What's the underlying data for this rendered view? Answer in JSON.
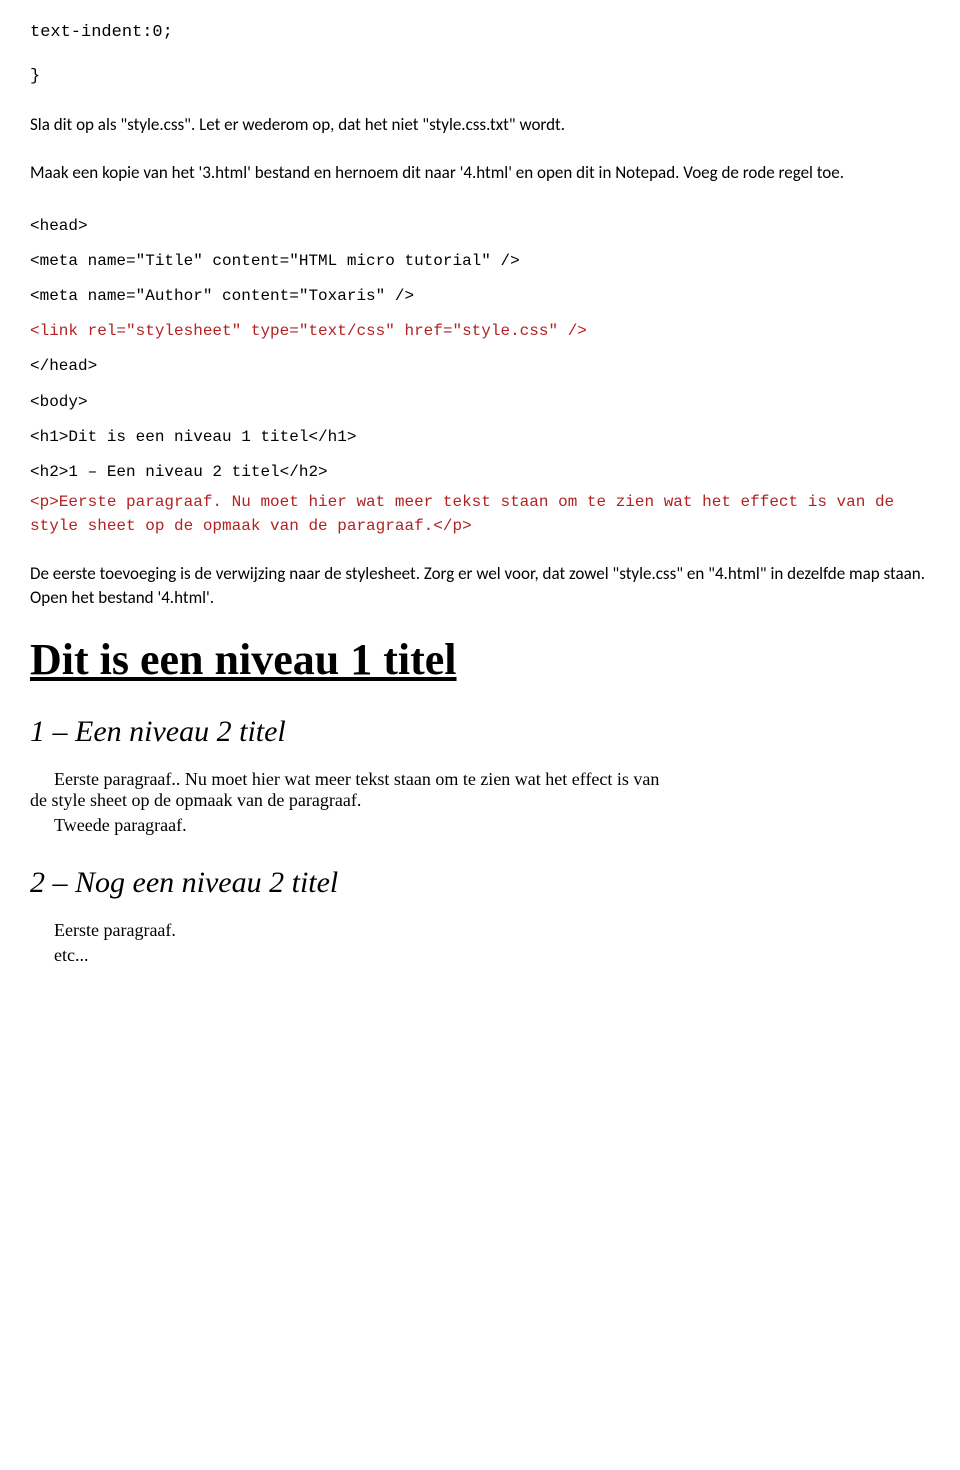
{
  "css_fragment": {
    "line1": "text-indent:0;",
    "line2": "}"
  },
  "instr1": "Sla dit op als \"style.css\". Let er wederom op, dat het niet \"style.css.txt\" wordt.",
  "instr2": "Maak een kopie van het '3.html' bestand en hernoem dit naar '4.html' en open dit in Notepad. Voeg de rode regel toe.",
  "code": {
    "l1": "<head>",
    "l2": "<meta name=\"Title\" content=\"HTML micro tutorial\" />",
    "l3": "<meta name=\"Author\" content=\"Toxaris\" />",
    "l4": "<link rel=\"stylesheet\" type=\"text/css\" href=\"style.css\" />",
    "l5": "</head>",
    "l6": "<body>",
    "l7": "<h1>Dit is een niveau 1 titel</h1>",
    "l8": "<h2>1 – Een niveau 2 titel</h2>",
    "l9": "<p>Eerste paragraaf. Nu moet hier wat meer tekst staan om te zien wat het effect is van de style sheet op de opmaak van de paragraaf.</p>"
  },
  "instr3": "De eerste toevoeging is de verwijzing naar de stylesheet. Zorg er wel voor, dat zowel \"style.css\" en \"4.html\" in dezelfde map staan. Open het bestand '4.html'.",
  "rendered": {
    "h1": "Dit is een niveau 1 titel",
    "h2a": "1 – Een niveau 2 titel",
    "p1": "Eerste paragraaf.. Nu moet hier wat meer tekst staan om te zien wat het effect is van de style sheet op de opmaak van de paragraaf.",
    "p2": "Tweede paragraaf.",
    "h2b": "2 – Nog een niveau 2 titel",
    "p3": "Eerste paragraaf.",
    "p4": "etc..."
  }
}
